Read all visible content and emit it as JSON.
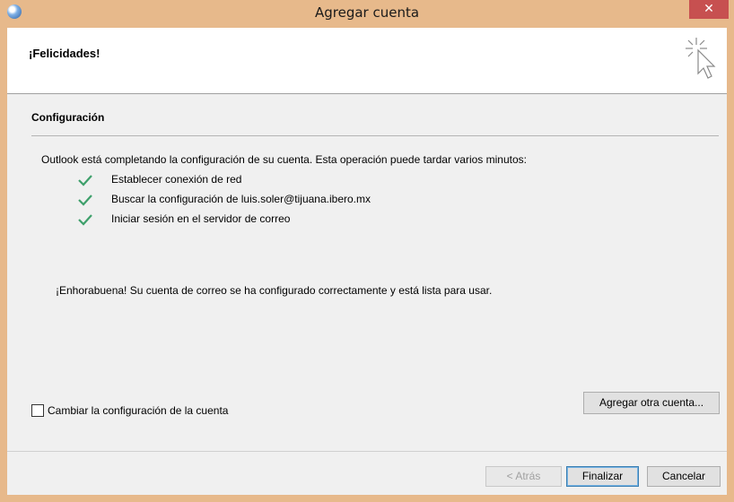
{
  "window": {
    "title": "Agregar cuenta",
    "close_label": "✕"
  },
  "banner": {
    "title": "¡Felicidades!"
  },
  "config": {
    "section_title": "Configuración",
    "intro": "Outlook está completando la configuración de su cuenta. Esta operación puede tardar varios minutos:",
    "steps": [
      {
        "label": "Establecer conexión de red",
        "status": "done"
      },
      {
        "label": "Buscar la configuración de luis.soler@tijuana.ibero.mx",
        "status": "done"
      },
      {
        "label": "Iniciar sesión en el servidor de correo",
        "status": "done"
      }
    ],
    "success_message": "¡Enhorabuena! Su cuenta de correo se ha configurado correctamente y está lista para usar."
  },
  "options": {
    "change_settings_label": "Cambiar la configuración de la cuenta",
    "change_settings_checked": false,
    "add_another_label": "Agregar otra cuenta..."
  },
  "footer": {
    "back_label": "< Atrás",
    "finish_label": "Finalizar",
    "cancel_label": "Cancelar"
  },
  "colors": {
    "frame": "#e7b98b",
    "close": "#c75050",
    "check": "#3ea06b"
  }
}
